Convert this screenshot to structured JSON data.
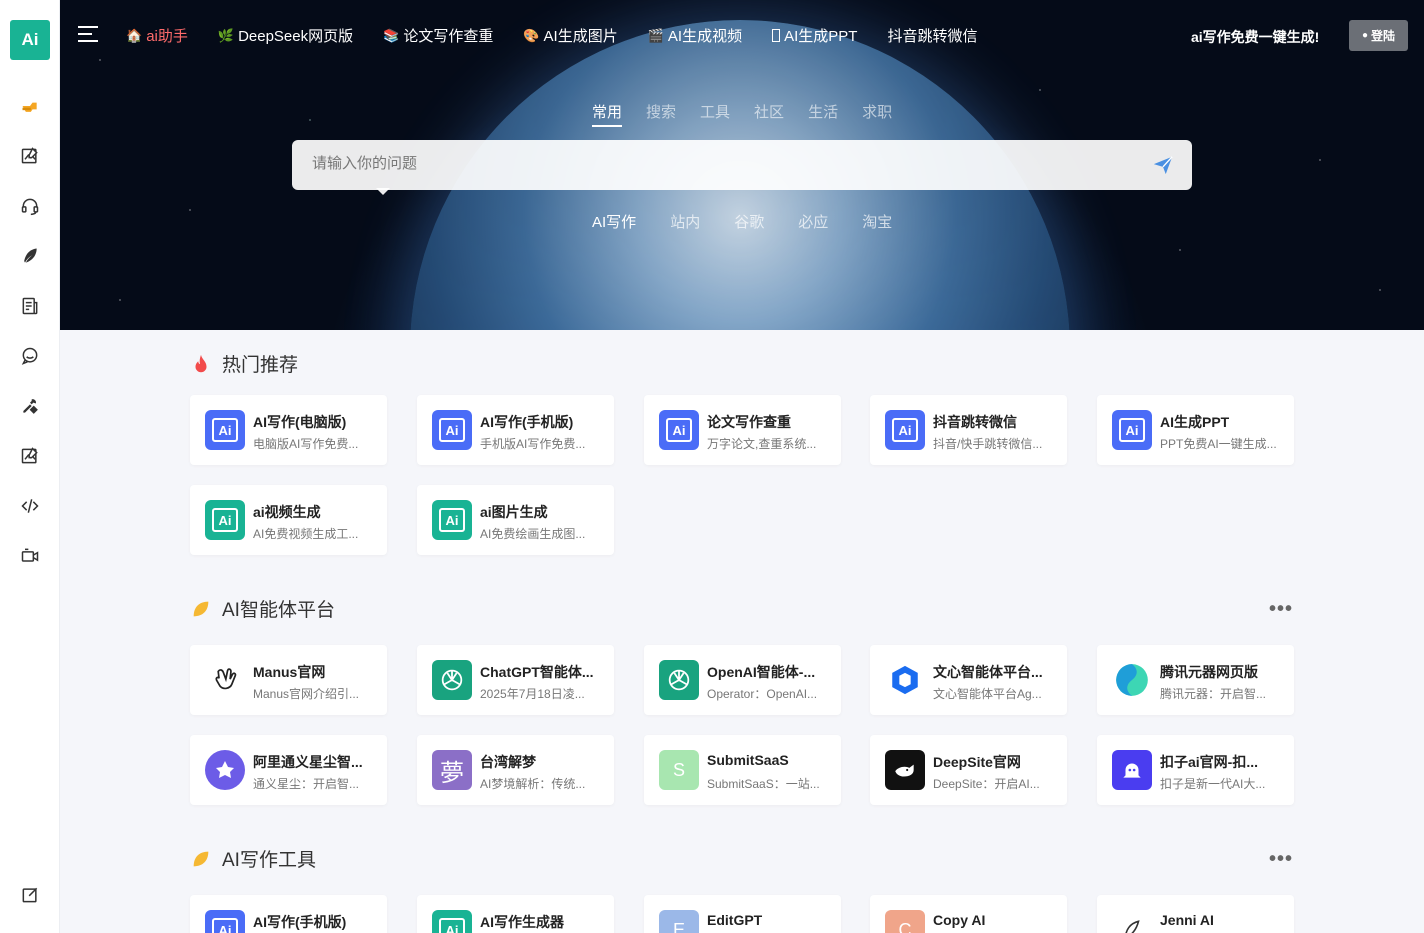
{
  "sidebar": {
    "logo_text": "Ai",
    "icons": [
      "pointing-hand-icon",
      "edit-image-icon",
      "headset-icon",
      "feather-icon",
      "document-icon",
      "chat-bubble-icon",
      "tools-icon",
      "edit-image-icon-2",
      "code-icon",
      "video-camera-icon"
    ],
    "bottom_icon": "edit-square-icon"
  },
  "header": {
    "nav": [
      {
        "emoji": "🏠",
        "label": "ai助手",
        "active": true
      },
      {
        "emoji": "🌿",
        "label": "DeepSeek网页版"
      },
      {
        "emoji": "📚",
        "label": "论文写作查重"
      },
      {
        "emoji": "🎨",
        "label": "AI生成图片"
      },
      {
        "emoji": "🎬",
        "label": "AI生成视频"
      },
      {
        "emoji": "",
        "label": "AI生成PPT"
      },
      {
        "emoji": "",
        "label": "抖音跳转微信"
      }
    ],
    "slogan": "ai写作免费一键生成!",
    "login_label": "登陆"
  },
  "search": {
    "category_tabs": [
      "常用",
      "搜索",
      "工具",
      "社区",
      "生活",
      "求职"
    ],
    "active_category": 0,
    "placeholder": "请输入你的问题",
    "engine_tabs": [
      "AI写作",
      "站内",
      "谷歌",
      "必应",
      "淘宝"
    ],
    "active_engine": 0
  },
  "sections": [
    {
      "title": "热门推荐",
      "icon": "fire-icon",
      "cards": [
        {
          "title": "AI写作(电脑版)",
          "desc": "电脑版AI写作免费...",
          "icon": "ai",
          "color": "#4a6cf7"
        },
        {
          "title": "AI写作(手机版)",
          "desc": "手机版AI写作免费...",
          "icon": "ai",
          "color": "#4a6cf7"
        },
        {
          "title": "论文写作查重",
          "desc": "万字论文,查重系统...",
          "icon": "ai",
          "color": "#4a6cf7"
        },
        {
          "title": "抖音跳转微信",
          "desc": "抖音/快手跳转微信...",
          "icon": "ai",
          "color": "#4a6cf7"
        },
        {
          "title": "AI生成PPT",
          "desc": "PPT免费AI一键生成...",
          "icon": "ai",
          "color": "#4a6cf7"
        },
        {
          "title": "ai视频生成",
          "desc": "AI免费视频生成工...",
          "icon": "ai",
          "color": "#19b394"
        },
        {
          "title": "ai图片生成",
          "desc": "AI免费绘画生成图...",
          "icon": "ai",
          "color": "#19b394"
        }
      ]
    },
    {
      "title": "AI智能体平台",
      "icon": "leaf-icon",
      "more": "•••",
      "cards": [
        {
          "title": "Manus官网",
          "desc": "Manus官网介绍引...",
          "icon": "manus",
          "color": "#ffffff"
        },
        {
          "title": "ChatGPT智能体...",
          "desc": "2025年7月18日凌...",
          "icon": "openai",
          "color": "#19a37f"
        },
        {
          "title": "OpenAI智能体-...",
          "desc": "Operator：OpenAI...",
          "icon": "openai",
          "color": "#19a37f"
        },
        {
          "title": "文心智能体平台...",
          "desc": "文心智能体平台Ag...",
          "icon": "wenxin",
          "color": "#ffffff"
        },
        {
          "title": "腾讯元器网页版",
          "desc": "腾讯元器：开启智...",
          "icon": "yuanqi",
          "color": "#ffffff"
        },
        {
          "title": "阿里通义星尘智...",
          "desc": "通义星尘：开启智...",
          "icon": "tongyi",
          "color": "#6c5ce7"
        },
        {
          "title": "台湾解梦",
          "desc": "AI梦境解析：传统...",
          "icon": "text",
          "text": "夢",
          "color": "#8b6fc7"
        },
        {
          "title": "SubmitSaaS",
          "desc": "SubmitSaaS：一站...",
          "icon": "text",
          "text": "S",
          "color": "#a8e6b0"
        },
        {
          "title": "DeepSite官网",
          "desc": "DeepSite：开启AI...",
          "icon": "deepsite",
          "color": "#111111"
        },
        {
          "title": "扣子ai官网-扣...",
          "desc": "扣子是新一代AI大...",
          "icon": "coze",
          "color": "#4a3df0"
        }
      ]
    },
    {
      "title": "AI写作工具",
      "icon": "leaf-icon",
      "more": "•••",
      "cards": [
        {
          "title": "AI写作(手机版)",
          "desc": "",
          "icon": "ai",
          "color": "#4a6cf7"
        },
        {
          "title": "AI写作生成器",
          "desc": "",
          "icon": "ai",
          "color": "#19b394"
        },
        {
          "title": "EditGPT",
          "desc": "",
          "icon": "text",
          "text": "E",
          "color": "#9bb8e8"
        },
        {
          "title": "Copy AI",
          "desc": "",
          "icon": "text",
          "text": "C",
          "color": "#f0a58a"
        },
        {
          "title": "Jenni AI",
          "desc": "",
          "icon": "jenni",
          "color": "#ffffff"
        }
      ]
    }
  ],
  "floating_tools": [
    "feather-icon",
    "bell-icon",
    "wechat-icon",
    "sun-icon"
  ]
}
